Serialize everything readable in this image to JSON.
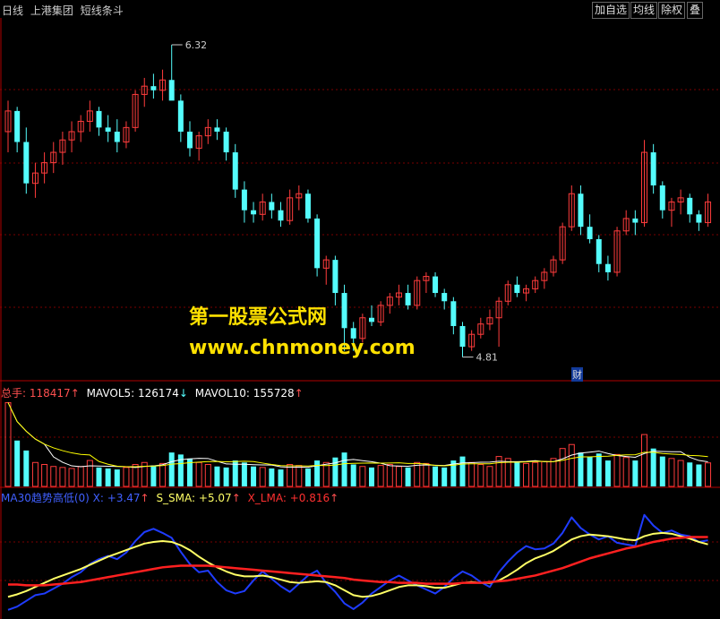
{
  "header": {
    "period": "日线",
    "stock_name": "上港集团",
    "indicator": "短线条斗",
    "toolbar": [
      "加自选",
      "均线",
      "除权",
      "叠"
    ]
  },
  "volume_legend": {
    "total_label": "总手:",
    "total_value": "118417",
    "total_arrow": "↑",
    "mavol5_label": "MAVOL5:",
    "mavol5_value": "126174",
    "mavol5_arrow": "↓",
    "mavol10_label": "MAVOL10:",
    "mavol10_value": "155728",
    "mavol10_arrow": "↑"
  },
  "indicator_legend": {
    "name": "MA30趋势高低(0)",
    "x_label": "X:",
    "x_value": "+3.47",
    "x_arrow": "↑",
    "s_label": "S_SMA:",
    "s_value": "+5.07",
    "s_arrow": "↑",
    "l_label": "X_LMA:",
    "l_value": "+0.816",
    "l_arrow": "↑"
  },
  "watermark": {
    "line1": "第一股票公式网",
    "line2": "www.chnmoney.com"
  },
  "event_flag": "财",
  "colors": {
    "up": "#ff3c3c",
    "down": "#54fcfc",
    "ma_white": "#ffffff",
    "ma_yellow": "#ffff00",
    "x_blue": "#1f3cff",
    "s_yellow": "#ffff66",
    "l_red": "#ff2020",
    "grid": "#7a0000"
  },
  "chart_data": [
    {
      "type": "candlestick",
      "name": "price",
      "annotations": [
        {
          "text": "6.32",
          "type": "high"
        },
        {
          "text": "4.81",
          "type": "low"
        }
      ],
      "ylim": [
        4.7,
        6.45
      ],
      "ohlc": [
        [
          5.9,
          6.05,
          5.8,
          6.0
        ],
        [
          6.0,
          6.02,
          5.8,
          5.85
        ],
        [
          5.85,
          5.92,
          5.6,
          5.65
        ],
        [
          5.65,
          5.75,
          5.58,
          5.7
        ],
        [
          5.7,
          5.8,
          5.65,
          5.75
        ],
        [
          5.75,
          5.85,
          5.7,
          5.8
        ],
        [
          5.8,
          5.9,
          5.74,
          5.86
        ],
        [
          5.86,
          5.95,
          5.8,
          5.9
        ],
        [
          5.9,
          5.98,
          5.85,
          5.95
        ],
        [
          5.95,
          6.05,
          5.9,
          6.0
        ],
        [
          6.0,
          6.02,
          5.88,
          5.92
        ],
        [
          5.92,
          5.98,
          5.85,
          5.9
        ],
        [
          5.9,
          5.96,
          5.8,
          5.85
        ],
        [
          5.85,
          5.95,
          5.82,
          5.92
        ],
        [
          5.92,
          6.1,
          5.9,
          6.08
        ],
        [
          6.08,
          6.16,
          6.02,
          6.12
        ],
        [
          6.12,
          6.18,
          6.06,
          6.1
        ],
        [
          6.1,
          6.2,
          6.05,
          6.15
        ],
        [
          6.15,
          6.32,
          6.1,
          6.05
        ],
        [
          6.05,
          6.08,
          5.85,
          5.9
        ],
        [
          5.9,
          5.95,
          5.78,
          5.82
        ],
        [
          5.82,
          5.9,
          5.76,
          5.88
        ],
        [
          5.88,
          5.96,
          5.84,
          5.92
        ],
        [
          5.92,
          5.96,
          5.86,
          5.9
        ],
        [
          5.9,
          5.92,
          5.76,
          5.8
        ],
        [
          5.8,
          5.84,
          5.58,
          5.62
        ],
        [
          5.62,
          5.66,
          5.46,
          5.52
        ],
        [
          5.52,
          5.56,
          5.46,
          5.5
        ],
        [
          5.5,
          5.6,
          5.47,
          5.56
        ],
        [
          5.56,
          5.6,
          5.48,
          5.52
        ],
        [
          5.52,
          5.56,
          5.44,
          5.47
        ],
        [
          5.47,
          5.62,
          5.45,
          5.58
        ],
        [
          5.58,
          5.64,
          5.52,
          5.6
        ],
        [
          5.6,
          5.62,
          5.46,
          5.48
        ],
        [
          5.48,
          5.5,
          5.2,
          5.24
        ],
        [
          5.24,
          5.3,
          5.16,
          5.28
        ],
        [
          5.28,
          5.3,
          5.06,
          5.12
        ],
        [
          5.12,
          5.16,
          4.84,
          4.95
        ],
        [
          4.95,
          4.98,
          4.84,
          4.9
        ],
        [
          4.9,
          5.02,
          4.88,
          5.0
        ],
        [
          5.0,
          5.06,
          4.96,
          4.98
        ],
        [
          4.98,
          5.08,
          4.96,
          5.06
        ],
        [
          5.06,
          5.12,
          5.02,
          5.1
        ],
        [
          5.1,
          5.16,
          5.06,
          5.12
        ],
        [
          5.12,
          5.16,
          5.04,
          5.06
        ],
        [
          5.06,
          5.2,
          5.04,
          5.18
        ],
        [
          5.18,
          5.22,
          5.12,
          5.2
        ],
        [
          5.2,
          5.22,
          5.1,
          5.12
        ],
        [
          5.12,
          5.14,
          5.04,
          5.08
        ],
        [
          5.08,
          5.1,
          4.92,
          4.96
        ],
        [
          4.96,
          4.98,
          4.81,
          4.86
        ],
        [
          4.86,
          4.94,
          4.84,
          4.92
        ],
        [
          4.92,
          5.0,
          4.9,
          4.97
        ],
        [
          4.97,
          5.04,
          4.94,
          5.0
        ],
        [
          5.0,
          5.1,
          4.86,
          5.08
        ],
        [
          5.08,
          5.18,
          5.06,
          5.16
        ],
        [
          5.16,
          5.2,
          5.1,
          5.12
        ],
        [
          5.12,
          5.16,
          5.08,
          5.14
        ],
        [
          5.14,
          5.2,
          5.12,
          5.18
        ],
        [
          5.18,
          5.24,
          5.14,
          5.22
        ],
        [
          5.22,
          5.3,
          5.2,
          5.28
        ],
        [
          5.28,
          5.46,
          5.26,
          5.44
        ],
        [
          5.44,
          5.64,
          5.42,
          5.6
        ],
        [
          5.6,
          5.64,
          5.4,
          5.44
        ],
        [
          5.44,
          5.5,
          5.36,
          5.38
        ],
        [
          5.38,
          5.4,
          5.22,
          5.26
        ],
        [
          5.26,
          5.3,
          5.18,
          5.22
        ],
        [
          5.22,
          5.44,
          5.2,
          5.42
        ],
        [
          5.42,
          5.52,
          5.4,
          5.48
        ],
        [
          5.48,
          5.52,
          5.4,
          5.46
        ],
        [
          5.46,
          5.86,
          5.44,
          5.8
        ],
        [
          5.8,
          5.84,
          5.6,
          5.64
        ],
        [
          5.64,
          5.66,
          5.48,
          5.52
        ],
        [
          5.52,
          5.58,
          5.44,
          5.56
        ],
        [
          5.56,
          5.62,
          5.5,
          5.58
        ],
        [
          5.58,
          5.6,
          5.46,
          5.5
        ],
        [
          5.5,
          5.52,
          5.42,
          5.46
        ],
        [
          5.46,
          5.6,
          5.44,
          5.56
        ]
      ]
    },
    {
      "type": "bar",
      "name": "volume",
      "values": [
        420,
        230,
        180,
        120,
        110,
        100,
        95,
        90,
        100,
        130,
        95,
        90,
        85,
        95,
        110,
        120,
        105,
        115,
        170,
        160,
        140,
        120,
        110,
        100,
        95,
        130,
        120,
        100,
        95,
        90,
        85,
        110,
        105,
        90,
        130,
        120,
        145,
        170,
        110,
        100,
        95,
        105,
        110,
        100,
        95,
        120,
        115,
        100,
        95,
        130,
        150,
        120,
        110,
        100,
        150,
        140,
        120,
        115,
        120,
        125,
        140,
        190,
        210,
        170,
        150,
        165,
        130,
        160,
        145,
        130,
        260,
        190,
        150,
        140,
        130,
        120,
        110,
        118
      ],
      "series": [
        {
          "name": "MAVOL5",
          "color": "white"
        },
        {
          "name": "MAVOL10",
          "color": "yellow"
        }
      ]
    },
    {
      "type": "line",
      "name": "indicator",
      "ylim": [
        -6,
        8
      ],
      "series": [
        {
          "name": "X",
          "values": [
            -5.0,
            -4.6,
            -3.9,
            -3.2,
            -3.0,
            -2.4,
            -1.8,
            -1.0,
            -0.4,
            0.6,
            1.2,
            1.6,
            1.2,
            2.0,
            3.4,
            4.5,
            4.9,
            4.4,
            3.8,
            2.1,
            0.6,
            -0.4,
            -0.2,
            -1.6,
            -2.6,
            -3.0,
            -2.7,
            -1.4,
            -0.3,
            -1.2,
            -2.1,
            -2.8,
            -1.8,
            -0.8,
            -0.2,
            -1.7,
            -2.8,
            -4.2,
            -4.9,
            -4.1,
            -3.0,
            -2.2,
            -1.4,
            -0.8,
            -1.4,
            -2.0,
            -2.5,
            -3.0,
            -2.2,
            -1.1,
            -0.3,
            -0.8,
            -1.6,
            -2.2,
            -0.4,
            0.9,
            2.0,
            2.8,
            2.4,
            2.5,
            3.1,
            4.4,
            6.3,
            5.0,
            4.2,
            3.6,
            4.0,
            3.2,
            3.0,
            2.8,
            6.6,
            5.3,
            4.4,
            4.7,
            4.2,
            4.0,
            3.3,
            3.5
          ]
        },
        {
          "name": "S_SMA",
          "values": [
            -3.4,
            -3.1,
            -2.7,
            -2.2,
            -1.7,
            -1.2,
            -0.8,
            -0.4,
            0.0,
            0.5,
            1.0,
            1.5,
            1.9,
            2.3,
            2.7,
            3.1,
            3.3,
            3.4,
            3.3,
            2.9,
            2.3,
            1.5,
            0.8,
            0.2,
            -0.3,
            -0.7,
            -0.9,
            -0.9,
            -0.8,
            -1.0,
            -1.3,
            -1.6,
            -1.7,
            -1.6,
            -1.5,
            -1.6,
            -2.0,
            -2.6,
            -3.2,
            -3.4,
            -3.3,
            -3.0,
            -2.6,
            -2.2,
            -2.0,
            -2.0,
            -2.1,
            -2.3,
            -2.3,
            -2.0,
            -1.7,
            -1.6,
            -1.7,
            -1.7,
            -1.4,
            -0.8,
            -0.1,
            0.7,
            1.3,
            1.7,
            2.2,
            2.9,
            3.6,
            4.0,
            4.2,
            4.1,
            4.0,
            3.8,
            3.6,
            3.5,
            4.0,
            4.3,
            4.4,
            4.3,
            4.0,
            3.7,
            3.3,
            3.0
          ]
        },
        {
          "name": "X_LMA",
          "values": [
            -1.9,
            -1.9,
            -2.0,
            -2.0,
            -2.0,
            -1.9,
            -1.8,
            -1.7,
            -1.6,
            -1.4,
            -1.2,
            -1.0,
            -0.8,
            -0.6,
            -0.4,
            -0.2,
            0.0,
            0.2,
            0.3,
            0.4,
            0.4,
            0.4,
            0.4,
            0.3,
            0.2,
            0.1,
            0.0,
            -0.1,
            -0.2,
            -0.3,
            -0.4,
            -0.5,
            -0.6,
            -0.7,
            -0.8,
            -0.9,
            -1.0,
            -1.1,
            -1.3,
            -1.4,
            -1.5,
            -1.6,
            -1.6,
            -1.7,
            -1.7,
            -1.7,
            -1.8,
            -1.8,
            -1.8,
            -1.8,
            -1.7,
            -1.7,
            -1.7,
            -1.6,
            -1.5,
            -1.4,
            -1.2,
            -1.0,
            -0.8,
            -0.5,
            -0.2,
            0.1,
            0.5,
            0.9,
            1.3,
            1.6,
            1.9,
            2.2,
            2.5,
            2.7,
            3.0,
            3.3,
            3.5,
            3.7,
            3.8,
            3.9,
            3.9,
            3.9
          ]
        }
      ]
    }
  ]
}
